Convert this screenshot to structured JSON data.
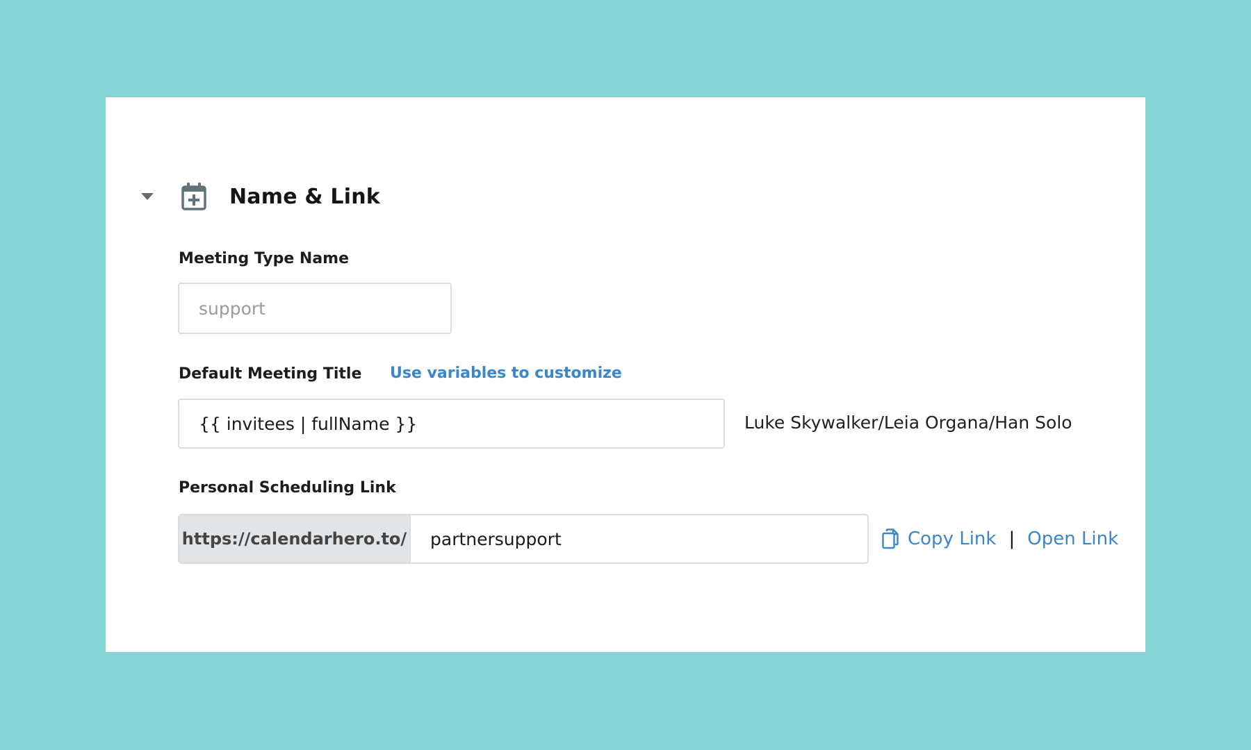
{
  "section": {
    "title": "Name & Link",
    "expanded": true
  },
  "meeting_type_name": {
    "label": "Meeting Type Name",
    "value": "",
    "placeholder": "support"
  },
  "default_meeting_title": {
    "label": "Default Meeting Title",
    "customize_link": "Use variables to customize",
    "value": "{{ invitees | fullName }}",
    "preview": "Luke Skywalker/Leia Organa/Han Solo"
  },
  "personal_scheduling_link": {
    "label": "Personal Scheduling Link",
    "prefix": "https://calendarhero.to/",
    "value": "partnersupport",
    "copy_label": "Copy Link",
    "separator": "|",
    "open_label": "Open Link"
  },
  "colors": {
    "background": "#86d5d5",
    "link": "#3a86c8",
    "icon": "#5f7379",
    "prefix_bg": "#e2e5e8"
  },
  "icons": {
    "collapse": "caret-down-icon",
    "section": "calendar-plus-icon",
    "copy": "copy-icon"
  }
}
